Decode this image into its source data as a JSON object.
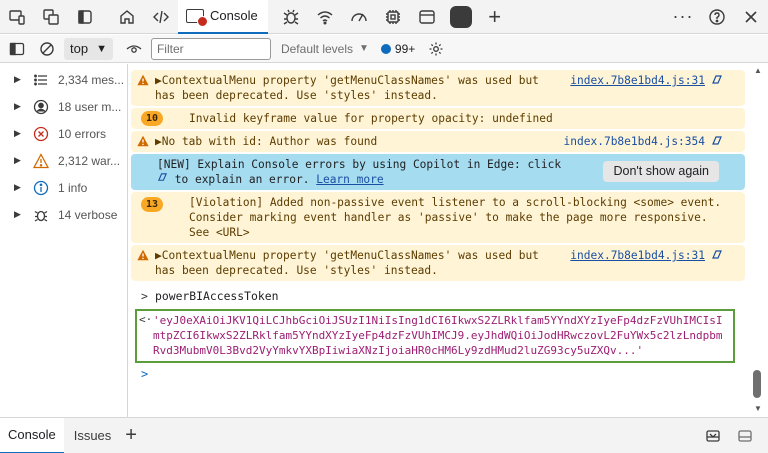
{
  "toolbar": {
    "tab_console": "Console",
    "icons": [
      "device-emulation-icon",
      "inspect-icon",
      "dock-icon",
      "home-icon",
      "elements-icon",
      "console-icon",
      "sources-bug-icon",
      "network-wifi-icon",
      "performance-icon",
      "memory-chip-icon",
      "application-window-icon",
      "record-stop-icon",
      "add-tool-icon",
      "more-icon",
      "help-icon",
      "close-icon"
    ]
  },
  "console_toolbar": {
    "context": "top",
    "filter_placeholder": "Filter",
    "levels": "Default levels",
    "issues_count": "99+"
  },
  "sidebar": {
    "items": [
      {
        "label": "2,334 mes...",
        "icon": "list-icon"
      },
      {
        "label": "18 user m...",
        "icon": "user-icon"
      },
      {
        "label": "10 errors",
        "icon": "error-icon"
      },
      {
        "label": "2,312 war...",
        "icon": "warning-icon"
      },
      {
        "label": "1 info",
        "icon": "info-icon"
      },
      {
        "label": "14 verbose",
        "icon": "verbose-bug-icon"
      }
    ]
  },
  "messages": {
    "m1": {
      "line1": "▶ContextualMenu property 'getMenuClassNames' was used but",
      "line2": "has been deprecated. Use 'styles' instead.",
      "source": "index.7b8e1bd4.js:31"
    },
    "m2": {
      "count": "10",
      "text": "Invalid keyframe value for property opacity: undefined"
    },
    "m3": {
      "text": "▶No tab with id: Author was found",
      "source": "index.7b8e1bd4.js:354"
    },
    "m4": {
      "line1": "[NEW] Explain Console errors by using Copilot in Edge: click",
      "line2_pre": "to explain an error.",
      "learn_more": "Learn more",
      "button": "Don't show again"
    },
    "m5": {
      "count": "13",
      "line1": "[Violation] Added non-passive event listener to a scroll-blocking <some> event.",
      "line2": "Consider marking event handler as 'passive' to make the page more responsive.",
      "line3": "See <URL>"
    },
    "m6": {
      "line1": "▶ContextualMenu property 'getMenuClassNames' was used but",
      "line2": "has been deprecated. Use 'styles' instead.",
      "source": "index.7b8e1bd4.js:31"
    },
    "input": "powerBIAccessToken",
    "result": "'eyJ0eXAiOiJKV1QiLCJhbGciOiJSUzI1NiIsIng1dCI6IkwxS2ZLRklfam5YYndXYzIyeFp4dzFzVUhIMCIsImtpZCI6IkwxS2ZLRklfam5YYndXYzIyeFp4dzFzVUhIMCJ9.eyJhdWQiOiJodHRwczovL2FuYWx5c2lzLndpbmRvd3MubmV0L3Bvd2VyYmkvYXBpIiwiaXNzIjoiaHR0cHM6Ly9zdHMud2luZG93cy5uZXQv...'"
  },
  "drawer": {
    "console": "Console",
    "issues": "Issues"
  }
}
